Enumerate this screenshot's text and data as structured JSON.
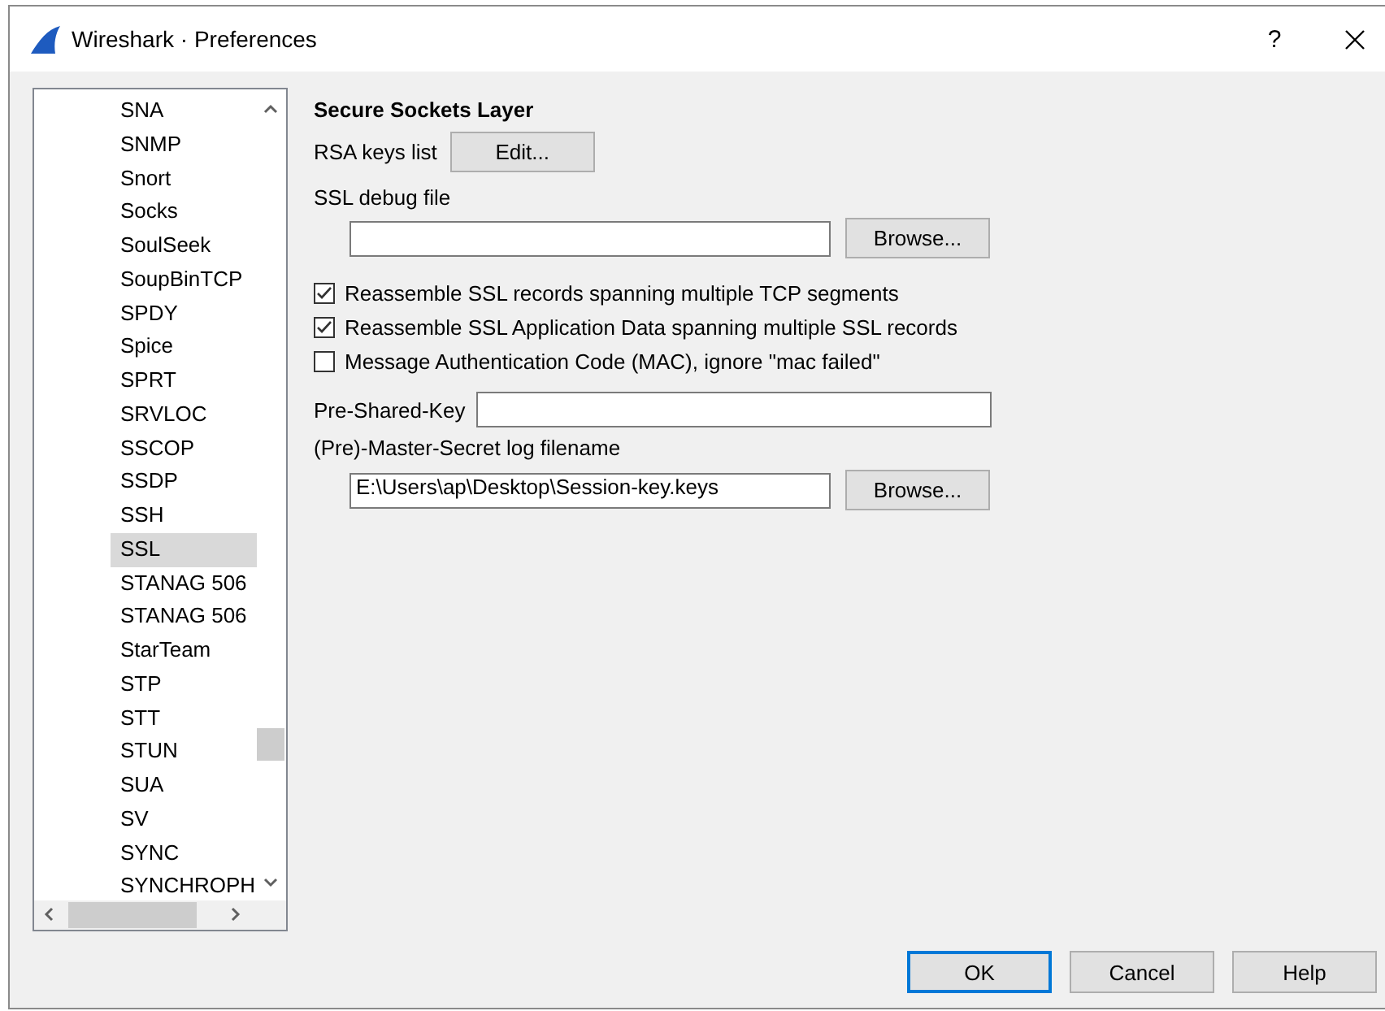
{
  "window": {
    "title": "Wireshark · Preferences",
    "help_glyph": "?"
  },
  "sidebar": {
    "items": [
      {
        "label": "SNA",
        "selected": false
      },
      {
        "label": "SNMP",
        "selected": false
      },
      {
        "label": "Snort",
        "selected": false
      },
      {
        "label": "Socks",
        "selected": false
      },
      {
        "label": "SoulSeek",
        "selected": false
      },
      {
        "label": "SoupBinTCP",
        "selected": false
      },
      {
        "label": "SPDY",
        "selected": false
      },
      {
        "label": "Spice",
        "selected": false
      },
      {
        "label": "SPRT",
        "selected": false
      },
      {
        "label": "SRVLOC",
        "selected": false
      },
      {
        "label": "SSCOP",
        "selected": false
      },
      {
        "label": "SSDP",
        "selected": false
      },
      {
        "label": "SSH",
        "selected": false
      },
      {
        "label": "SSL",
        "selected": true
      },
      {
        "label": "STANAG 506",
        "selected": false
      },
      {
        "label": "STANAG 506",
        "selected": false
      },
      {
        "label": "StarTeam",
        "selected": false
      },
      {
        "label": "STP",
        "selected": false
      },
      {
        "label": "STT",
        "selected": false
      },
      {
        "label": "STUN",
        "selected": false
      },
      {
        "label": "SUA",
        "selected": false
      },
      {
        "label": "SV",
        "selected": false
      },
      {
        "label": "SYNC",
        "selected": false
      },
      {
        "label": "SYNCHROPH",
        "selected": false
      }
    ]
  },
  "panel": {
    "heading": "Secure Sockets Layer",
    "rsa_keys": {
      "label": "RSA keys list",
      "button": "Edit..."
    },
    "debug_file": {
      "label": "SSL debug file",
      "button": "Browse..."
    },
    "options": [
      {
        "label": "Reassemble SSL records spanning multiple TCP segments",
        "checked": true
      },
      {
        "label": "Reassemble SSL Application Data spanning multiple SSL records",
        "checked": true
      },
      {
        "label": "Message Authentication Code (MAC), ignore \"mac failed\"",
        "checked": false
      }
    ],
    "pre_shared_key": {
      "label": "Pre-Shared-Key"
    },
    "master_secret": {
      "label": "(Pre)-Master-Secret log filename",
      "value": "E:\\Users\\ap\\Desktop\\Session-key.keys",
      "button": "Browse..."
    }
  },
  "buttons": [
    {
      "label": "OK",
      "default": true
    },
    {
      "label": "Cancel",
      "default": false
    },
    {
      "label": "Help",
      "default": false
    }
  ]
}
